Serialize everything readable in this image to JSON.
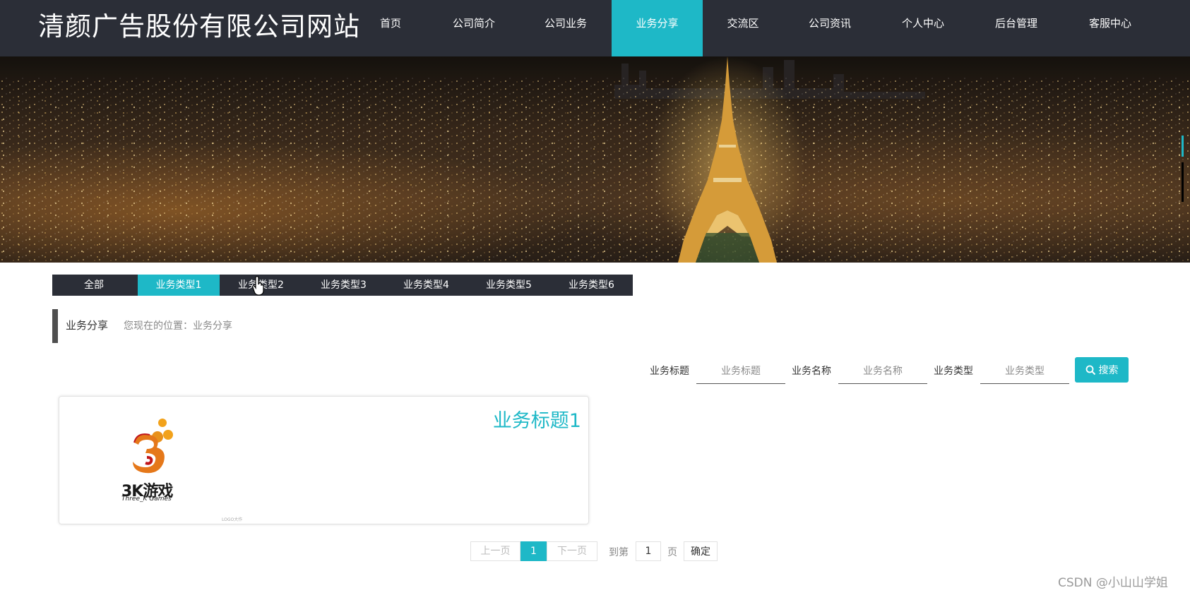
{
  "header": {
    "site_title": "清颜广告股份有限公司网站",
    "nav": [
      {
        "label": "首页"
      },
      {
        "label": "公司简介"
      },
      {
        "label": "公司业务"
      },
      {
        "label": "业务分享",
        "active": true
      },
      {
        "label": "交流区"
      },
      {
        "label": "公司资讯"
      },
      {
        "label": "个人中心"
      },
      {
        "label": "后台管理"
      },
      {
        "label": "客服中心"
      }
    ]
  },
  "banner": {
    "image": "paris-night-eiffel-tower",
    "slide_count": 3,
    "active_slide": 1
  },
  "categories": {
    "tabs": [
      {
        "label": "全部"
      },
      {
        "label": "业务类型1",
        "active": true
      },
      {
        "label": "业务类型2"
      },
      {
        "label": "业务类型3"
      },
      {
        "label": "业务类型4"
      },
      {
        "label": "业务类型5"
      },
      {
        "label": "业务类型6"
      }
    ]
  },
  "section": {
    "title": "业务分享",
    "breadcrumb": "您现在的位置：业务分享"
  },
  "search": {
    "fields": [
      {
        "label": "业务标题",
        "placeholder": "业务标题"
      },
      {
        "label": "业务名称",
        "placeholder": "业务名称"
      },
      {
        "label": "业务类型",
        "placeholder": "业务类型"
      }
    ],
    "button_label": "搜索",
    "button_icon": "search-icon"
  },
  "items": [
    {
      "title": "业务标题1",
      "logo_text": "3K游戏",
      "logo_sub": "Three_K Games",
      "logo_caption": "LOGO大作"
    }
  ],
  "pagination": {
    "prev_label": "上一页",
    "current_page": "1",
    "next_label": "下一页",
    "goto_label": "到第",
    "goto_value": "1",
    "page_unit": "页",
    "confirm_label": "确定"
  },
  "watermark": "CSDN @小山山学姐",
  "colors": {
    "accent": "#1eb8c7",
    "header_bg": "#2b2e37"
  }
}
